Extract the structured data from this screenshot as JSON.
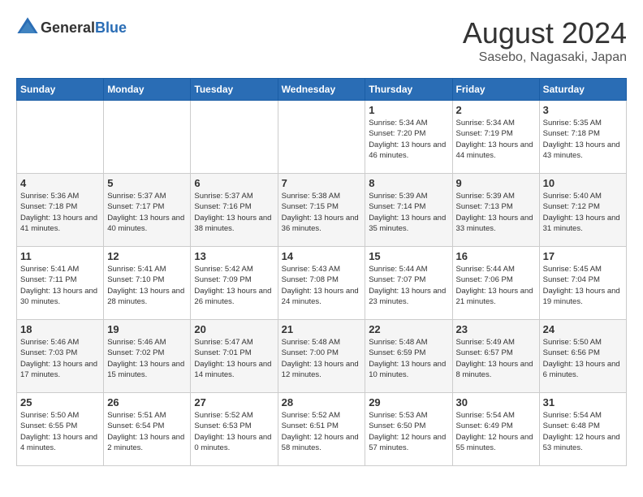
{
  "header": {
    "logo_general": "General",
    "logo_blue": "Blue",
    "month_year": "August 2024",
    "location": "Sasebo, Nagasaki, Japan"
  },
  "columns": [
    "Sunday",
    "Monday",
    "Tuesday",
    "Wednesday",
    "Thursday",
    "Friday",
    "Saturday"
  ],
  "weeks": [
    [
      {
        "day": "",
        "sunrise": "",
        "sunset": "",
        "daylight": ""
      },
      {
        "day": "",
        "sunrise": "",
        "sunset": "",
        "daylight": ""
      },
      {
        "day": "",
        "sunrise": "",
        "sunset": "",
        "daylight": ""
      },
      {
        "day": "",
        "sunrise": "",
        "sunset": "",
        "daylight": ""
      },
      {
        "day": "1",
        "sunrise": "Sunrise: 5:34 AM",
        "sunset": "Sunset: 7:20 PM",
        "daylight": "Daylight: 13 hours and 46 minutes."
      },
      {
        "day": "2",
        "sunrise": "Sunrise: 5:34 AM",
        "sunset": "Sunset: 7:19 PM",
        "daylight": "Daylight: 13 hours and 44 minutes."
      },
      {
        "day": "3",
        "sunrise": "Sunrise: 5:35 AM",
        "sunset": "Sunset: 7:18 PM",
        "daylight": "Daylight: 13 hours and 43 minutes."
      }
    ],
    [
      {
        "day": "4",
        "sunrise": "Sunrise: 5:36 AM",
        "sunset": "Sunset: 7:18 PM",
        "daylight": "Daylight: 13 hours and 41 minutes."
      },
      {
        "day": "5",
        "sunrise": "Sunrise: 5:37 AM",
        "sunset": "Sunset: 7:17 PM",
        "daylight": "Daylight: 13 hours and 40 minutes."
      },
      {
        "day": "6",
        "sunrise": "Sunrise: 5:37 AM",
        "sunset": "Sunset: 7:16 PM",
        "daylight": "Daylight: 13 hours and 38 minutes."
      },
      {
        "day": "7",
        "sunrise": "Sunrise: 5:38 AM",
        "sunset": "Sunset: 7:15 PM",
        "daylight": "Daylight: 13 hours and 36 minutes."
      },
      {
        "day": "8",
        "sunrise": "Sunrise: 5:39 AM",
        "sunset": "Sunset: 7:14 PM",
        "daylight": "Daylight: 13 hours and 35 minutes."
      },
      {
        "day": "9",
        "sunrise": "Sunrise: 5:39 AM",
        "sunset": "Sunset: 7:13 PM",
        "daylight": "Daylight: 13 hours and 33 minutes."
      },
      {
        "day": "10",
        "sunrise": "Sunrise: 5:40 AM",
        "sunset": "Sunset: 7:12 PM",
        "daylight": "Daylight: 13 hours and 31 minutes."
      }
    ],
    [
      {
        "day": "11",
        "sunrise": "Sunrise: 5:41 AM",
        "sunset": "Sunset: 7:11 PM",
        "daylight": "Daylight: 13 hours and 30 minutes."
      },
      {
        "day": "12",
        "sunrise": "Sunrise: 5:41 AM",
        "sunset": "Sunset: 7:10 PM",
        "daylight": "Daylight: 13 hours and 28 minutes."
      },
      {
        "day": "13",
        "sunrise": "Sunrise: 5:42 AM",
        "sunset": "Sunset: 7:09 PM",
        "daylight": "Daylight: 13 hours and 26 minutes."
      },
      {
        "day": "14",
        "sunrise": "Sunrise: 5:43 AM",
        "sunset": "Sunset: 7:08 PM",
        "daylight": "Daylight: 13 hours and 24 minutes."
      },
      {
        "day": "15",
        "sunrise": "Sunrise: 5:44 AM",
        "sunset": "Sunset: 7:07 PM",
        "daylight": "Daylight: 13 hours and 23 minutes."
      },
      {
        "day": "16",
        "sunrise": "Sunrise: 5:44 AM",
        "sunset": "Sunset: 7:06 PM",
        "daylight": "Daylight: 13 hours and 21 minutes."
      },
      {
        "day": "17",
        "sunrise": "Sunrise: 5:45 AM",
        "sunset": "Sunset: 7:04 PM",
        "daylight": "Daylight: 13 hours and 19 minutes."
      }
    ],
    [
      {
        "day": "18",
        "sunrise": "Sunrise: 5:46 AM",
        "sunset": "Sunset: 7:03 PM",
        "daylight": "Daylight: 13 hours and 17 minutes."
      },
      {
        "day": "19",
        "sunrise": "Sunrise: 5:46 AM",
        "sunset": "Sunset: 7:02 PM",
        "daylight": "Daylight: 13 hours and 15 minutes."
      },
      {
        "day": "20",
        "sunrise": "Sunrise: 5:47 AM",
        "sunset": "Sunset: 7:01 PM",
        "daylight": "Daylight: 13 hours and 14 minutes."
      },
      {
        "day": "21",
        "sunrise": "Sunrise: 5:48 AM",
        "sunset": "Sunset: 7:00 PM",
        "daylight": "Daylight: 13 hours and 12 minutes."
      },
      {
        "day": "22",
        "sunrise": "Sunrise: 5:48 AM",
        "sunset": "Sunset: 6:59 PM",
        "daylight": "Daylight: 13 hours and 10 minutes."
      },
      {
        "day": "23",
        "sunrise": "Sunrise: 5:49 AM",
        "sunset": "Sunset: 6:57 PM",
        "daylight": "Daylight: 13 hours and 8 minutes."
      },
      {
        "day": "24",
        "sunrise": "Sunrise: 5:50 AM",
        "sunset": "Sunset: 6:56 PM",
        "daylight": "Daylight: 13 hours and 6 minutes."
      }
    ],
    [
      {
        "day": "25",
        "sunrise": "Sunrise: 5:50 AM",
        "sunset": "Sunset: 6:55 PM",
        "daylight": "Daylight: 13 hours and 4 minutes."
      },
      {
        "day": "26",
        "sunrise": "Sunrise: 5:51 AM",
        "sunset": "Sunset: 6:54 PM",
        "daylight": "Daylight: 13 hours and 2 minutes."
      },
      {
        "day": "27",
        "sunrise": "Sunrise: 5:52 AM",
        "sunset": "Sunset: 6:53 PM",
        "daylight": "Daylight: 13 hours and 0 minutes."
      },
      {
        "day": "28",
        "sunrise": "Sunrise: 5:52 AM",
        "sunset": "Sunset: 6:51 PM",
        "daylight": "Daylight: 12 hours and 58 minutes."
      },
      {
        "day": "29",
        "sunrise": "Sunrise: 5:53 AM",
        "sunset": "Sunset: 6:50 PM",
        "daylight": "Daylight: 12 hours and 57 minutes."
      },
      {
        "day": "30",
        "sunrise": "Sunrise: 5:54 AM",
        "sunset": "Sunset: 6:49 PM",
        "daylight": "Daylight: 12 hours and 55 minutes."
      },
      {
        "day": "31",
        "sunrise": "Sunrise: 5:54 AM",
        "sunset": "Sunset: 6:48 PM",
        "daylight": "Daylight: 12 hours and 53 minutes."
      }
    ]
  ]
}
